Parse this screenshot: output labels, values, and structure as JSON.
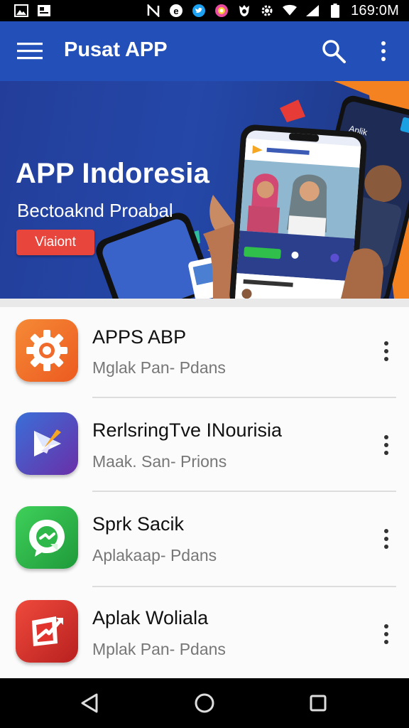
{
  "status_bar": {
    "time": "169:0M",
    "icons": [
      "image-icon",
      "gallery-icon",
      "nfc-off-icon",
      "e-app-icon",
      "twitter-icon",
      "browser-icon",
      "shield-icon",
      "settings-icon",
      "wifi-icon",
      "signal-icon",
      "battery-icon"
    ]
  },
  "app_bar": {
    "title": "Pusat APP",
    "icons": [
      "menu-icon",
      "search-icon",
      "more-vert-icon"
    ]
  },
  "banner": {
    "title": "APP Indoresia",
    "subtitle": "Bectoaknd Proabal",
    "button_label": "Viaiont",
    "colors": {
      "background": "#2447a8",
      "button": "#e8453c",
      "accent": "#f58220"
    }
  },
  "apps": [
    {
      "name": "APPS ABP",
      "subtitle": "Mglak Pan- Pdans",
      "icon": "gear-icon",
      "icon_color": "#f06a2a"
    },
    {
      "name": "RerlsringTve INourisia",
      "subtitle": "Maak. San- Prions",
      "icon": "paper-plane-icon",
      "icon_color": "#4a3fb0"
    },
    {
      "name": "Sprk Sacik",
      "subtitle": "Aplakaap- Pdans",
      "icon": "chat-bubble-icon",
      "icon_color": "#2fb84a"
    },
    {
      "name": "Aplak Woliala",
      "subtitle": "Mplak Pan- Pdans",
      "icon": "trend-arrow-icon",
      "icon_color": "#d9302c"
    }
  ],
  "nav_bar": {
    "buttons": [
      "back-icon",
      "home-icon",
      "recents-icon"
    ]
  }
}
